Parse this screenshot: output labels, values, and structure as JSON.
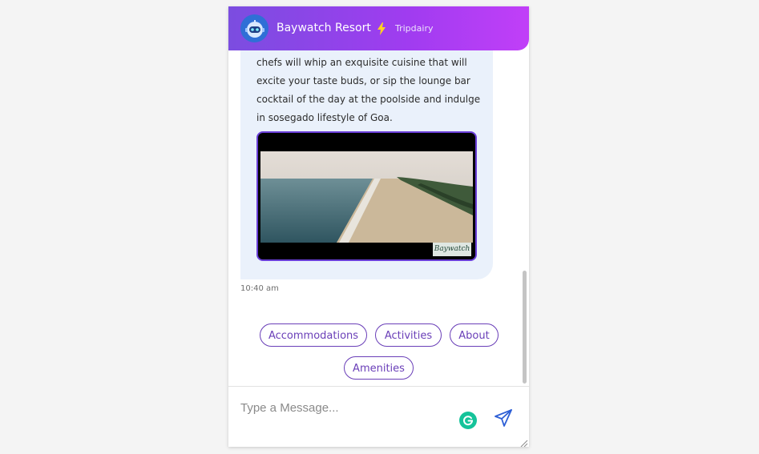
{
  "header": {
    "bot_name": "Baywatch Resort",
    "powered_by": "Tripdairy",
    "avatar_icon": "robot-icon",
    "bolt_icon": "lightning-bolt-icon",
    "gradient_start": "#7b4de0",
    "gradient_end": "#c13ff8"
  },
  "message": {
    "lines": [
      "chefs will whip an exquisite cuisine that will",
      "excite your taste buds, or sip the lounge bar",
      "cocktail of the day at the poolside and indulge",
      "in sosegado lifestyle of Goa."
    ],
    "video_watermark": "Baywatch",
    "time": "10:40 am"
  },
  "quick_replies": [
    "Accommodations",
    "Activities",
    "About",
    "Amenities"
  ],
  "composer": {
    "placeholder": "Type a Message...",
    "send_icon": "send-icon",
    "grammarly_icon": "grammarly-icon"
  },
  "colors": {
    "accent": "#6a3fb8",
    "bubble": "#eaf1fb"
  }
}
